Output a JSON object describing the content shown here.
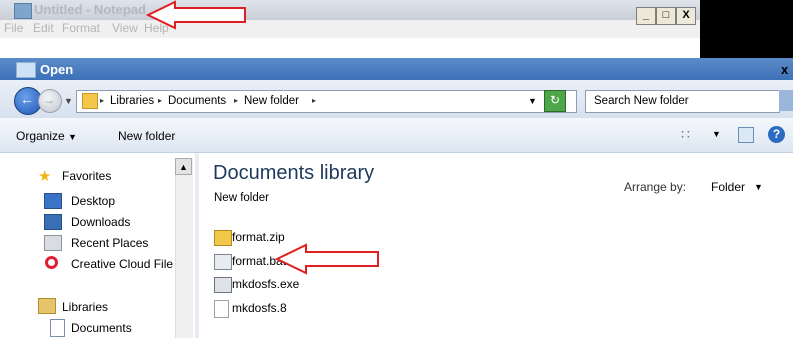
{
  "notepad": {
    "title": "Untitled - Notepad",
    "menu": [
      "File",
      "Edit",
      "Format",
      "View",
      "Help"
    ],
    "controls": [
      "_",
      "□",
      "X"
    ]
  },
  "dialog": {
    "title": "Open",
    "close": "x",
    "breadcrumbs": [
      "Libraries",
      "Documents",
      "New folder"
    ],
    "search_placeholder": "Search New folder",
    "organize_label": "Organize",
    "new_folder_label": "New folder",
    "help": "?"
  },
  "nav": {
    "items": [
      "Favorites",
      "Desktop",
      "Downloads",
      "Recent Places",
      "Creative Cloud File",
      "Libraries",
      "Documents"
    ]
  },
  "content": {
    "library_title": "Documents library",
    "library_subtitle": "New folder",
    "arrange_label": "Arrange by:",
    "arrange_value": "Folder",
    "files": [
      "format.zip",
      "format.bat",
      "mkdosfs.exe",
      "mkdosfs.8"
    ]
  },
  "colors": {
    "annotation_arrow": "#e02020",
    "title_bar": "#3c70b8",
    "library_title": "#1e395b"
  }
}
